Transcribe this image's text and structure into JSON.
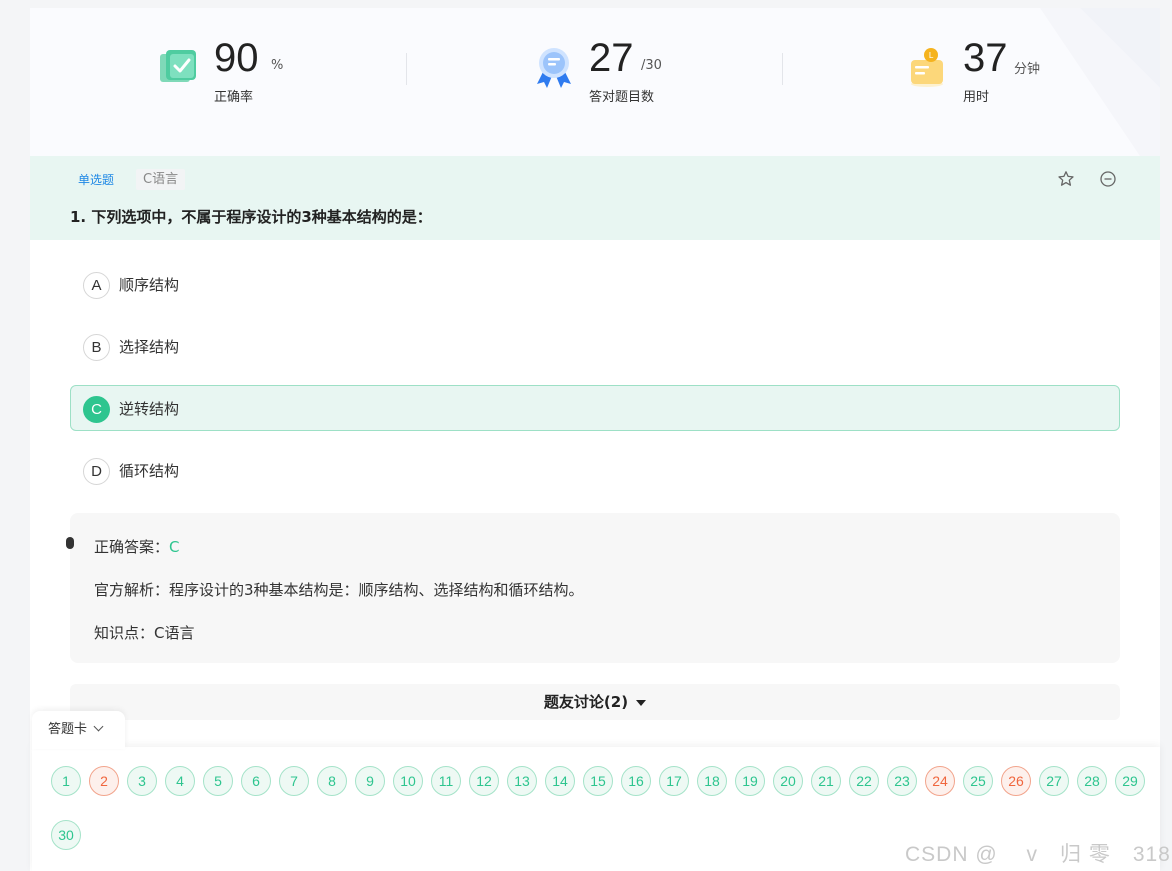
{
  "stats": {
    "accuracy": {
      "value": "90",
      "unit": "%",
      "label": "正确率",
      "icon": "check-book-icon"
    },
    "correct": {
      "value": "27",
      "unit": "/30",
      "label": "答对题目数",
      "icon": "ribbon-badge-icon"
    },
    "time": {
      "value": "37",
      "unit": "分钟",
      "label": "用时",
      "icon": "timer-bell-icon"
    }
  },
  "question": {
    "type_tag": "单选题",
    "category_tag": "C语言",
    "title": "1. 下列选项中，不属于程序设计的3种基本结构的是：",
    "options": [
      {
        "letter": "A",
        "text": "顺序结构"
      },
      {
        "letter": "B",
        "text": "选择结构"
      },
      {
        "letter": "C",
        "text": "逆转结构"
      },
      {
        "letter": "D",
        "text": "循环结构"
      }
    ],
    "selected": "C",
    "actions": {
      "favorite_icon": "star-icon",
      "remove_icon": "minus-circle-icon"
    }
  },
  "analysis": {
    "answer_label": "正确答案：",
    "answer_value": "C",
    "explanation": "官方解析：程序设计的3种基本结构是：顺序结构、选择结构和循环结构。",
    "knowledge": "知识点：C语言"
  },
  "discussion": {
    "label": "题友讨论(2)"
  },
  "answer_card": {
    "label": "答题卡",
    "numbers": [
      "1",
      "2",
      "3",
      "4",
      "5",
      "6",
      "7",
      "8",
      "9",
      "10",
      "11",
      "12",
      "13",
      "14",
      "15",
      "16",
      "17",
      "18",
      "19",
      "20",
      "21",
      "22",
      "23",
      "24",
      "25",
      "26",
      "27",
      "28",
      "29",
      "30"
    ],
    "wrong": [
      "2",
      "24",
      "26"
    ]
  },
  "watermark": "CSDN @　 v　归 零　318",
  "colors": {
    "accent_green": "#2ec58f",
    "wrong_red": "#f0663e",
    "tag_blue": "#1e88e5",
    "header_tint": "#e8f6f2"
  }
}
